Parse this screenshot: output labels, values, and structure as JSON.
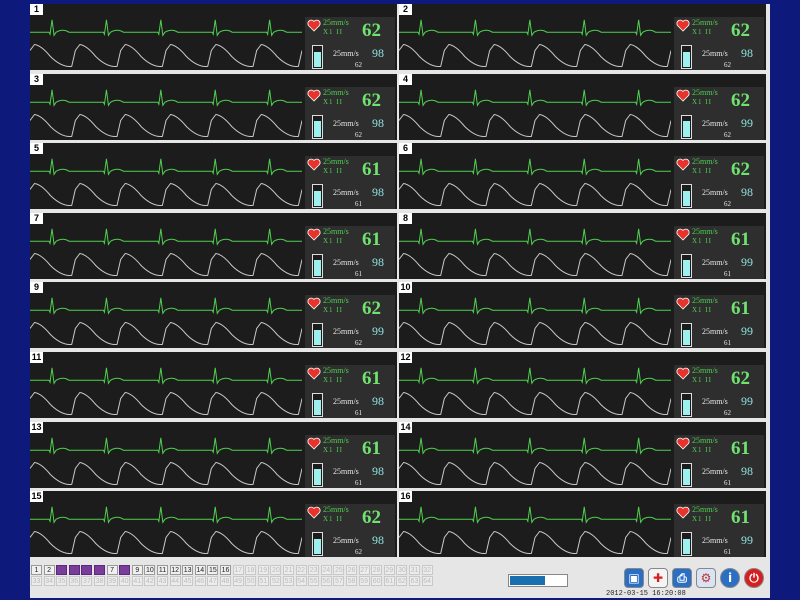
{
  "monitor": {
    "beds": [
      {
        "num": "1",
        "speed_ecg": "25mm/s",
        "lead": "X1   II",
        "hr": "62",
        "speed_spo2": "25mm/s",
        "spo2": "98",
        "pulse": "62"
      },
      {
        "num": "2",
        "speed_ecg": "25mm/s",
        "lead": "X1   II",
        "hr": "62",
        "speed_spo2": "25mm/s",
        "spo2": "98",
        "pulse": "62"
      },
      {
        "num": "3",
        "speed_ecg": "25mm/s",
        "lead": "X1   II",
        "hr": "62",
        "speed_spo2": "25mm/s",
        "spo2": "98",
        "pulse": "62"
      },
      {
        "num": "4",
        "speed_ecg": "25mm/s",
        "lead": "X1   II",
        "hr": "62",
        "speed_spo2": "25mm/s",
        "spo2": "99",
        "pulse": "62"
      },
      {
        "num": "5",
        "speed_ecg": "25mm/s",
        "lead": "X1   II",
        "hr": "61",
        "speed_spo2": "25mm/s",
        "spo2": "98",
        "pulse": "61"
      },
      {
        "num": "6",
        "speed_ecg": "25mm/s",
        "lead": "X1   II",
        "hr": "62",
        "speed_spo2": "25mm/s",
        "spo2": "98",
        "pulse": "62"
      },
      {
        "num": "7",
        "speed_ecg": "25mm/s",
        "lead": "X1   II",
        "hr": "61",
        "speed_spo2": "25mm/s",
        "spo2": "98",
        "pulse": "61"
      },
      {
        "num": "8",
        "speed_ecg": "25mm/s",
        "lead": "X1   II",
        "hr": "61",
        "speed_spo2": "25mm/s",
        "spo2": "99",
        "pulse": "61"
      },
      {
        "num": "9",
        "speed_ecg": "25mm/s",
        "lead": "X1   II",
        "hr": "62",
        "speed_spo2": "25mm/s",
        "spo2": "99",
        "pulse": "62"
      },
      {
        "num": "10",
        "speed_ecg": "25mm/s",
        "lead": "X1   II",
        "hr": "61",
        "speed_spo2": "25mm/s",
        "spo2": "99",
        "pulse": "61"
      },
      {
        "num": "11",
        "speed_ecg": "25mm/s",
        "lead": "X1   II",
        "hr": "61",
        "speed_spo2": "25mm/s",
        "spo2": "98",
        "pulse": "61"
      },
      {
        "num": "12",
        "speed_ecg": "25mm/s",
        "lead": "X1   II",
        "hr": "62",
        "speed_spo2": "25mm/s",
        "spo2": "99",
        "pulse": "62"
      },
      {
        "num": "13",
        "speed_ecg": "25mm/s",
        "lead": "X1   II",
        "hr": "61",
        "speed_spo2": "25mm/s",
        "spo2": "98",
        "pulse": "61"
      },
      {
        "num": "14",
        "speed_ecg": "25mm/s",
        "lead": "X1   II",
        "hr": "61",
        "speed_spo2": "25mm/s",
        "spo2": "98",
        "pulse": "61"
      },
      {
        "num": "15",
        "speed_ecg": "25mm/s",
        "lead": "X1   II",
        "hr": "62",
        "speed_spo2": "25mm/s",
        "spo2": "98",
        "pulse": "62"
      },
      {
        "num": "16",
        "speed_ecg": "25mm/s",
        "lead": "X1   II",
        "hr": "61",
        "speed_spo2": "25mm/s",
        "spo2": "99",
        "pulse": "61"
      }
    ]
  },
  "bed_pages": {
    "row1": [
      "1",
      "2",
      "3",
      "4",
      "5",
      "6",
      "7",
      "8",
      "9",
      "10",
      "11",
      "12",
      "13",
      "14",
      "15",
      "16",
      "17",
      "18",
      "19",
      "20",
      "21",
      "22",
      "23",
      "24",
      "25",
      "26",
      "27",
      "28",
      "29",
      "30",
      "31",
      "32"
    ],
    "row2": [
      "33",
      "34",
      "35",
      "36",
      "37",
      "38",
      "39",
      "40",
      "41",
      "42",
      "43",
      "44",
      "45",
      "46",
      "47",
      "48",
      "49",
      "50",
      "51",
      "52",
      "53",
      "54",
      "55",
      "56",
      "57",
      "58",
      "59",
      "60",
      "61",
      "62",
      "63",
      "64"
    ],
    "active": [
      "3",
      "4",
      "5",
      "6",
      "8"
    ],
    "enabled_max": 16
  },
  "progress": {
    "fraction": 0.62
  },
  "toolbar": {
    "icons": [
      "monitor-icon",
      "medical-cross-icon",
      "printer-icon",
      "settings-icon",
      "info-icon",
      "power-icon"
    ]
  },
  "status": {
    "datetime": "2012-03-15 16:20:08"
  },
  "colors": {
    "background": "#0d1a7c",
    "ecg": "#4fd04f",
    "spo2_wave": "#c8c8c8",
    "hr_value": "#6fe26f",
    "spo2_value": "#8fe2e0",
    "active_page": "#7a3d9c"
  }
}
